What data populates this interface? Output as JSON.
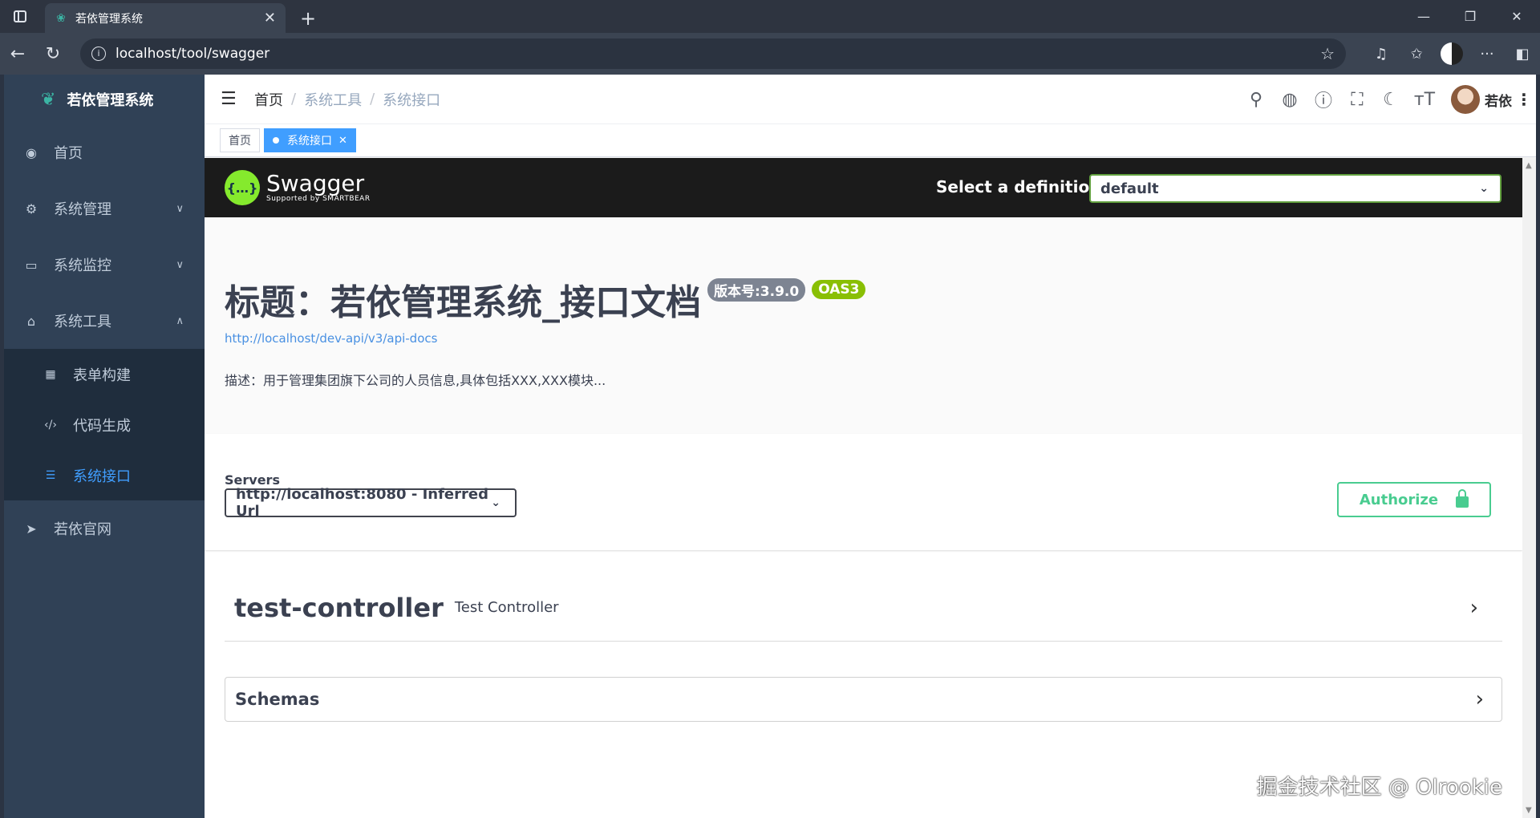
{
  "browser": {
    "tab_title": "若依管理系统",
    "url": "localhost/tool/swagger"
  },
  "sidebar": {
    "logo_title": "若依管理系统",
    "items": [
      {
        "label": "首页"
      },
      {
        "label": "系统管理"
      },
      {
        "label": "系统监控"
      },
      {
        "label": "系统工具"
      }
    ],
    "subitems": [
      {
        "label": "表单构建"
      },
      {
        "label": "代码生成"
      },
      {
        "label": "系统接口"
      }
    ],
    "bottom_item": {
      "label": "若依官网"
    }
  },
  "navbar": {
    "breadcrumb": [
      "首页",
      "系统工具",
      "系统接口"
    ],
    "separator": "/",
    "username": "若依"
  },
  "tags": {
    "home": "首页",
    "active": "系统接口"
  },
  "swagger": {
    "logo_name": "Swagger",
    "logo_by": "Supported by SMARTBEAR",
    "select_label": "Select a definition",
    "select_value": "default",
    "title": "标题：若依管理系统_接口文档",
    "version_badge": "版本号:3.9.0",
    "oas_badge": "OAS3",
    "doc_link": "http://localhost/dev-api/v3/api-docs",
    "description": "描述：用于管理集团旗下公司的人员信息,具体包括XXX,XXX模块...",
    "servers_label": "Servers",
    "server_value": "http://localhost:8080 - Inferred Url",
    "authorize_label": "Authorize",
    "tag_name": "test-controller",
    "tag_desc": "Test Controller",
    "schemas_label": "Schemas"
  },
  "watermark": "掘金技术社区 @ Olrookie",
  "colors": {
    "sidebar_bg": "#304156",
    "sidebar_active": "#409eff",
    "swagger_green": "#85ea2d",
    "authorize_green": "#49cc90",
    "oas_badge": "#89bf04"
  }
}
